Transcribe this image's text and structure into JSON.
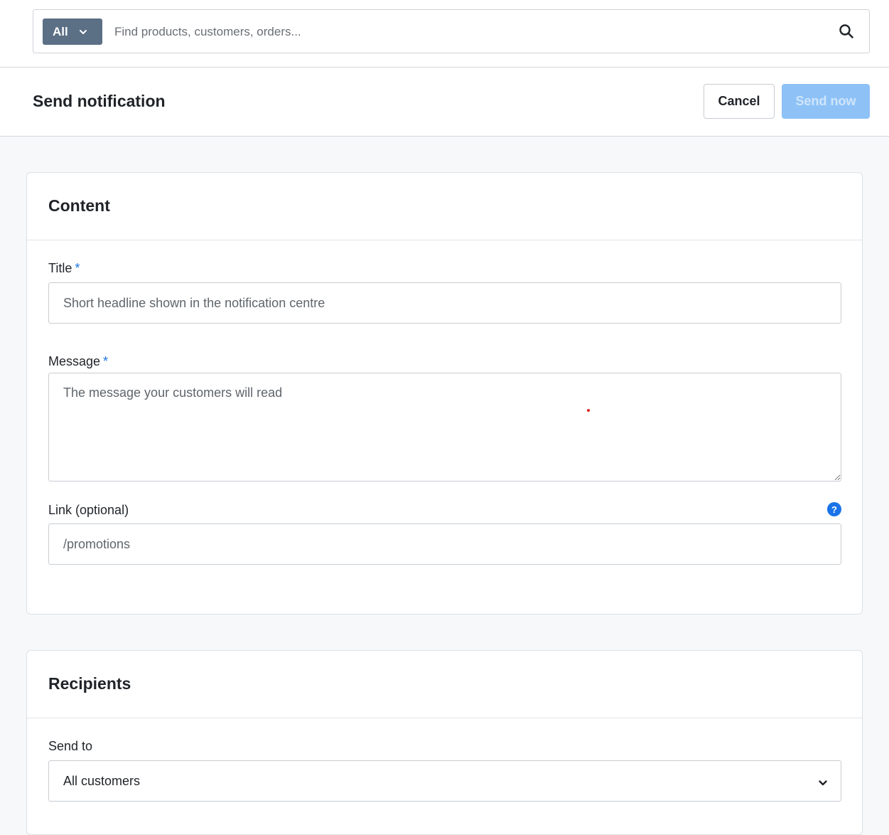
{
  "search": {
    "scope_label": "All",
    "placeholder": "Find products, customers, orders..."
  },
  "header": {
    "title": "Send notification",
    "cancel_label": "Cancel",
    "send_label": "Send now"
  },
  "content_card": {
    "title": "Content",
    "title_field": {
      "label": "Title",
      "required_mark": "*",
      "placeholder": "Short headline shown in the notification centre"
    },
    "message_field": {
      "label": "Message",
      "required_mark": "*",
      "placeholder": "The message your customers will read"
    },
    "link_field": {
      "label": "Link (optional)",
      "placeholder": "/promotions",
      "help_glyph": "?"
    }
  },
  "recipients_card": {
    "title": "Recipients",
    "send_to": {
      "label": "Send to",
      "selected": "All customers"
    }
  },
  "colors": {
    "scope_button": "#5b6f85",
    "primary_disabled": "#8ec2f7",
    "accent": "#1a73e8"
  },
  "icons": {
    "search": "search-icon",
    "scope_chevron": "chevron-down-icon",
    "help": "help-icon",
    "select_chevron": "chevron-down-icon"
  }
}
